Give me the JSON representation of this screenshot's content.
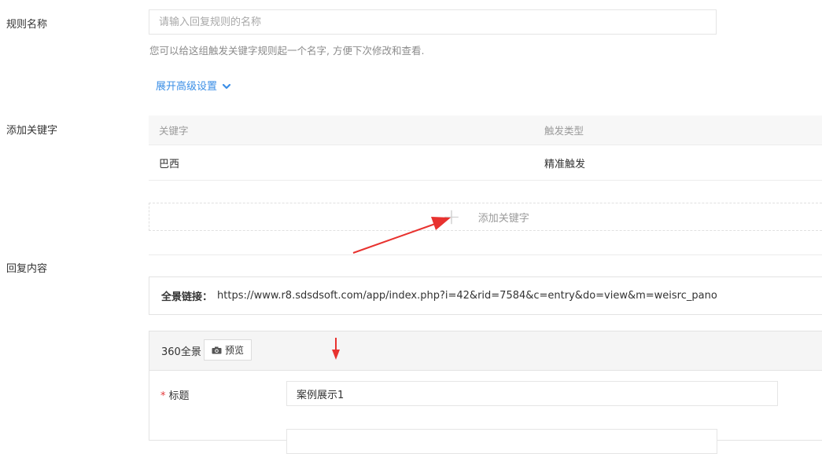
{
  "rule_name": {
    "label": "规则名称",
    "placeholder": "请输入回复规则的名称",
    "help": "您可以给这组触发关键字规则起一个名字, 方便下次修改和查看.",
    "advanced_toggle": "展开高级设置"
  },
  "keywords": {
    "label": "添加关键字",
    "columns": [
      "关键字",
      "触发类型"
    ],
    "rows": [
      {
        "keyword": "巴西",
        "trigger_type": "精准触发"
      }
    ],
    "add_label": "添加关键字"
  },
  "reply": {
    "label": "回复内容",
    "link_label": "全景链接：",
    "link_url": "https://www.r8.sdsdsoft.com/app/index.php?i=42&rid=7584&c=entry&do=view&m=weisrc_pano",
    "panel_title": "360全景",
    "preview_button": "预览",
    "title_label": "标题",
    "title_value": "案例展示1"
  },
  "colors": {
    "link": "#3a8ee6",
    "annotation_arrow": "#e8322f",
    "required_star": "#e4393c"
  }
}
